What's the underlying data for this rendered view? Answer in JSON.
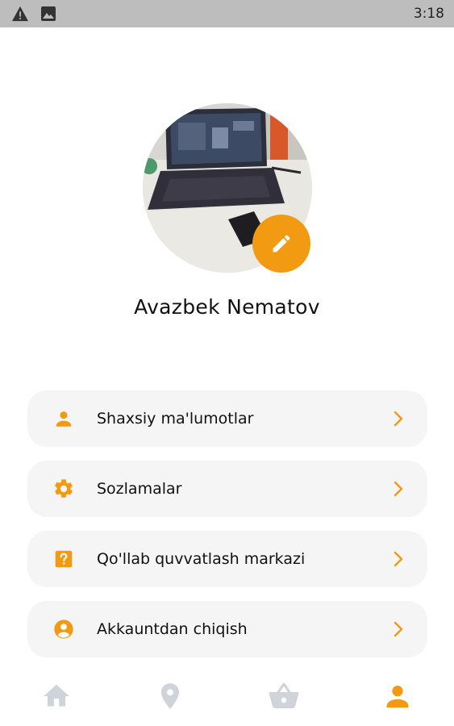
{
  "status_bar": {
    "time": "3:18",
    "icons": [
      "warning-icon",
      "image-icon"
    ]
  },
  "profile": {
    "name": "Avazbek Nematov",
    "avatar": "laptop-photo",
    "edit_icon": "pencil-icon"
  },
  "menu": [
    {
      "label": "Shaxsiy ma'lumotlar",
      "icon": "person-icon"
    },
    {
      "label": "Sozlamalar",
      "icon": "gear-icon"
    },
    {
      "label": "Qo'llab quvvatlash markazi",
      "icon": "help-icon"
    },
    {
      "label": "Akkauntdan chiqish",
      "icon": "account-circle-icon"
    }
  ],
  "bottom_nav": [
    {
      "icon": "home-icon",
      "active": false
    },
    {
      "icon": "location-icon",
      "active": false
    },
    {
      "icon": "basket-icon",
      "active": false
    },
    {
      "icon": "person-icon",
      "active": true
    }
  ],
  "colors": {
    "accent": "#f29a11",
    "inactive": "#cfd4da",
    "card": "#f5f5f5"
  }
}
